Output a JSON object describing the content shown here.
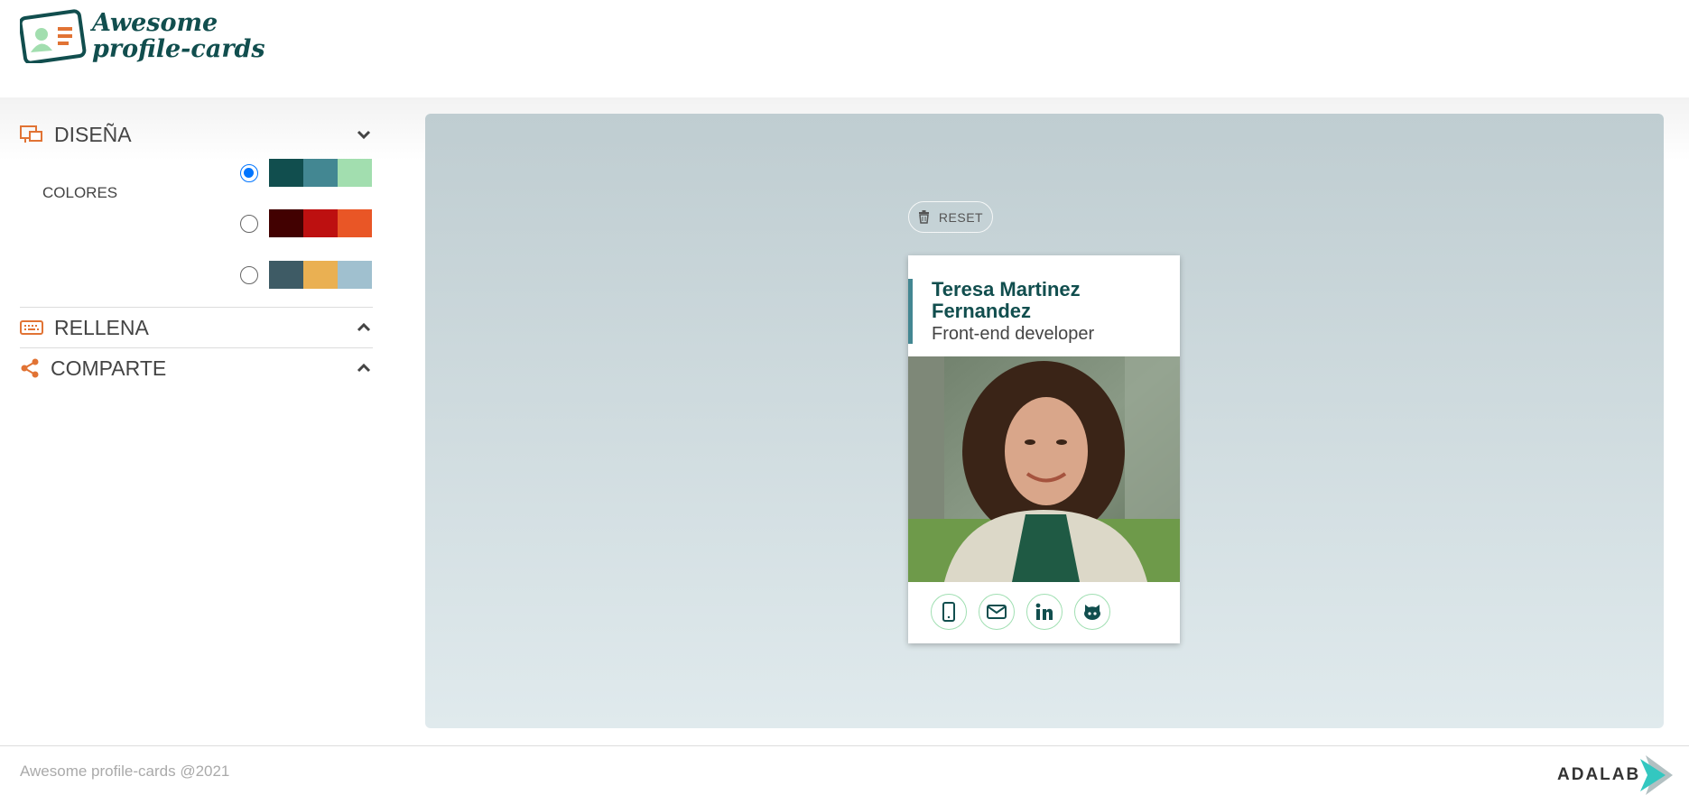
{
  "header": {
    "logo_line1": "Awesome",
    "logo_line2": "profile-cards",
    "logo_icon": "profile-card-icon"
  },
  "sidebar": {
    "sections": [
      {
        "label": "DISEÑA",
        "icon": "design-icon",
        "expanded": true,
        "chevron": "chevron-down-icon"
      },
      {
        "label": "RELLENA",
        "icon": "keyboard-icon",
        "expanded": false,
        "chevron": "chevron-up-icon"
      },
      {
        "label": "COMPARTE",
        "icon": "share-icon",
        "expanded": false,
        "chevron": "chevron-up-icon"
      }
    ],
    "colors_label": "COLORES",
    "palettes": [
      {
        "selected": true,
        "colors": [
          "#114e4e",
          "#438792",
          "#a2deaf"
        ]
      },
      {
        "selected": false,
        "colors": [
          "#420101",
          "#bd1010",
          "#e95626"
        ]
      },
      {
        "selected": false,
        "colors": [
          "#3e5b65",
          "#eab052",
          "#a0c0cf"
        ]
      }
    ]
  },
  "preview": {
    "reset_label": "RESET",
    "reset_icon": "trash-icon",
    "card": {
      "name": "Teresa Martinez Fernandez",
      "job": "Front-end developer",
      "accent": "#438792",
      "social": [
        "phone-icon",
        "email-icon",
        "linkedin-icon",
        "github-icon"
      ]
    }
  },
  "footer": {
    "copyright": "Awesome profile-cards @2021",
    "brand": "ADALAB"
  },
  "colors": {
    "brand_dark": "#114e4e",
    "accent_orange": "#e17334",
    "social_border": "#a0dfb2"
  }
}
